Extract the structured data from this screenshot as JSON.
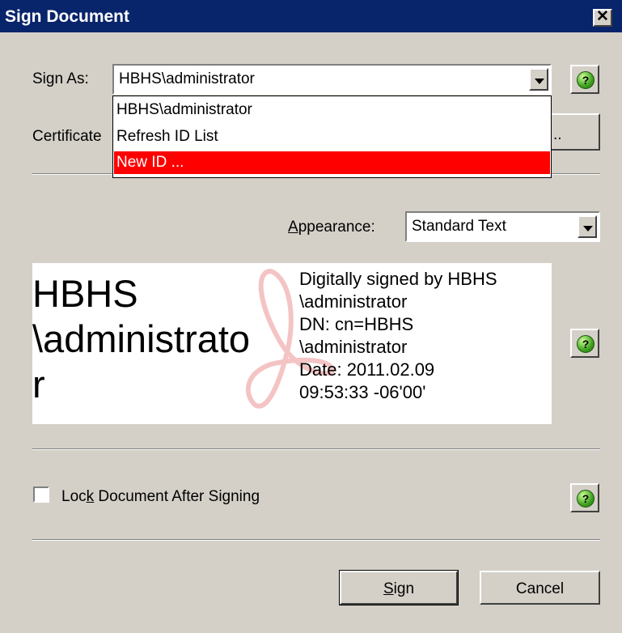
{
  "window": {
    "title": "Sign Document",
    "close_glyph": "✕"
  },
  "sign_as": {
    "label_pre": "Si",
    "label_u": "g",
    "label_post": "n As:",
    "value": "HBHS\\administrator"
  },
  "certificate": {
    "label": "Certificate",
    "button": ".."
  },
  "dropdown": {
    "items": [
      {
        "label": "HBHS\\administrator",
        "selected": false
      },
      {
        "label": "Refresh ID List",
        "selected": false
      },
      {
        "label": "New ID ...",
        "selected": true
      }
    ]
  },
  "appearance": {
    "label_u": "A",
    "label_post": "ppearance:",
    "value": "Standard Text"
  },
  "preview": {
    "name_lines": [
      "HBHS",
      "\\administrato",
      "r"
    ],
    "detail_lines": [
      "Digitally signed by HBHS",
      "\\administrator",
      "DN: cn=HBHS",
      "\\administrator",
      "Date: 2011.02.09",
      "09:53:33 -06'00'"
    ]
  },
  "lock": {
    "label_pre": "Loc",
    "label_u": "k",
    "label_post": " Document After Signing",
    "checked": false
  },
  "buttons": {
    "sign_u": "S",
    "sign_post": "ign",
    "cancel": "Cancel"
  },
  "help_glyph": "?",
  "colors": {
    "titlebar": "#08246b",
    "selection": "#ff0000",
    "face": "#d4d0c8"
  }
}
